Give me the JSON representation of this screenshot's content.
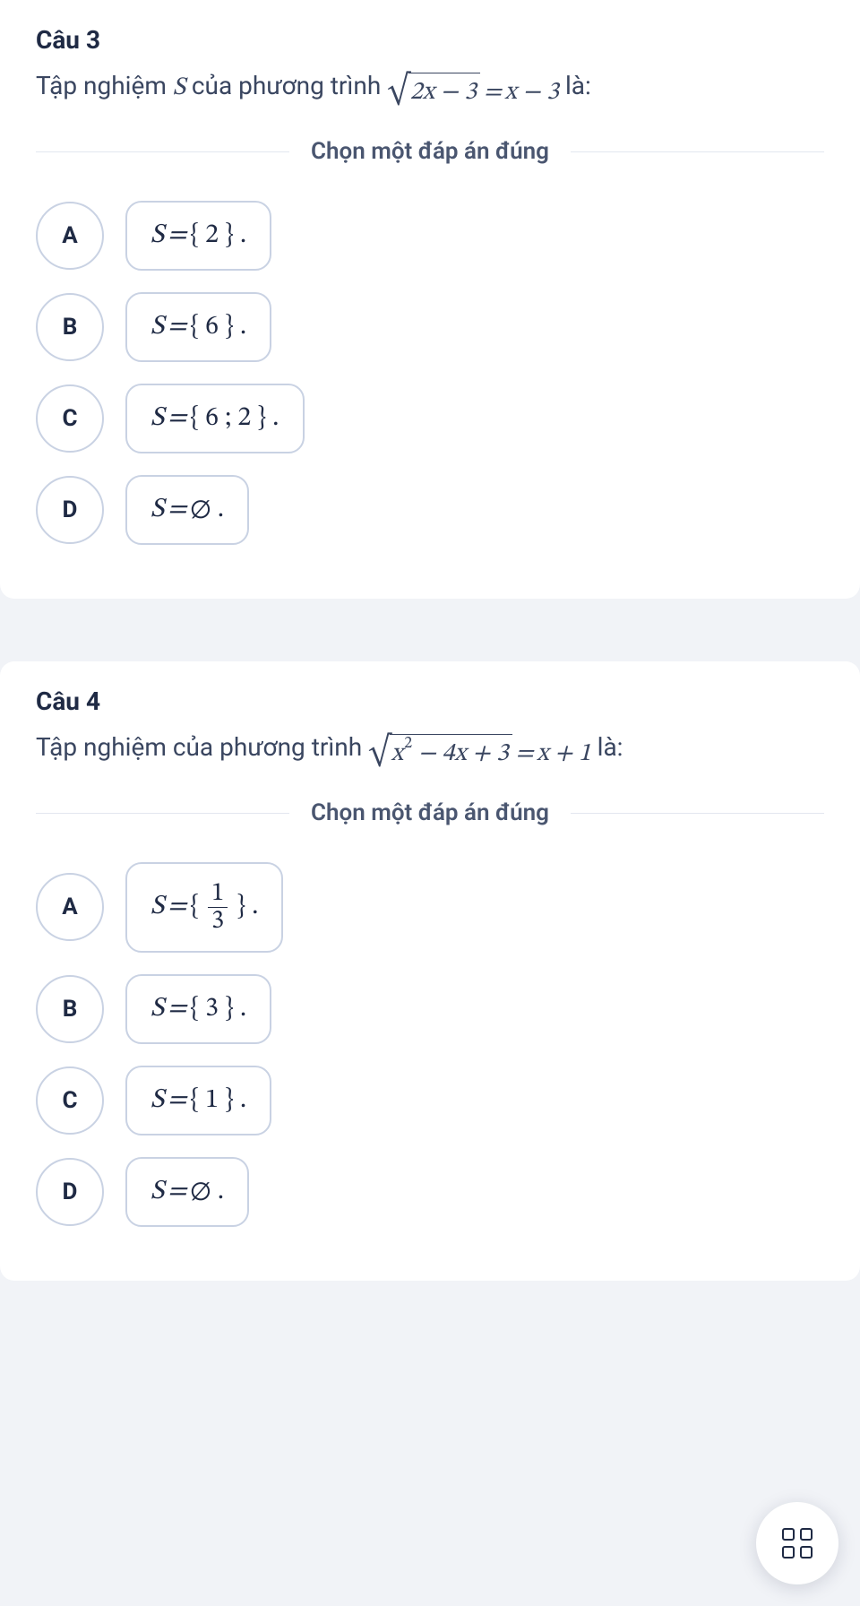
{
  "q3": {
    "title": "Câu 3",
    "text_prefix": "Tập nghiệm ",
    "text_mid": " của phương trình ",
    "text_suffix": " là:",
    "sqrt_expr": "2x − 3",
    "rhs": "x − 3",
    "instruction": "Chọn một đáp án đúng",
    "options": {
      "A": {
        "label": "A",
        "content": "S = { 2 } ."
      },
      "B": {
        "label": "B",
        "content": "S = { 6 } ."
      },
      "C": {
        "label": "C",
        "content": "S = { 6 ; 2 } ."
      },
      "D": {
        "label": "D",
        "content": "S = ∅ ."
      }
    }
  },
  "q4": {
    "title": "Câu 4",
    "text_prefix": "Tập nghiệm của phương trình ",
    "text_suffix": " là:",
    "sqrt_expr_a": "x",
    "sqrt_expr_b": " − 4x + 3",
    "sqrt_sup": "2",
    "rhs": "x + 1",
    "instruction": "Chọn một đáp án đúng",
    "options": {
      "A": {
        "label": "A",
        "prefix": "S = { ",
        "num": "1",
        "den": "3",
        "suffix": " } ."
      },
      "B": {
        "label": "B",
        "content": "S = { 3 } ."
      },
      "C": {
        "label": "C",
        "content": "S = { 1 } ."
      },
      "D": {
        "label": "D",
        "content": "S = ∅ ."
      }
    }
  }
}
